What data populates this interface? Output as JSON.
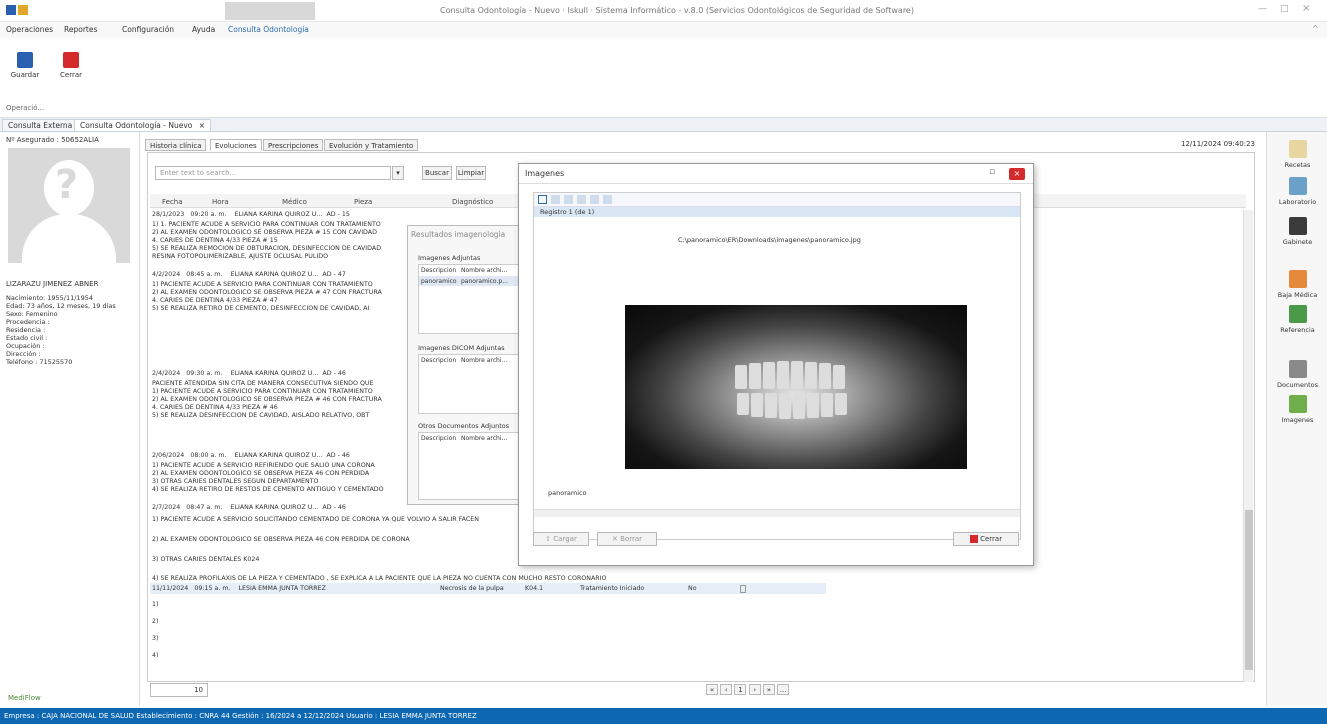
{
  "window": {
    "title": "Consulta Odontología - Nuevo · Iskull · Sistema Informático - v.8.0 (Servicios Odontológicos de Seguridad de Software)",
    "controls": [
      "—",
      "□",
      "×"
    ]
  },
  "menu": {
    "items": [
      "Operaciones",
      "Reportes",
      "Configuración",
      "Ayuda",
      "Consulta Odontología"
    ]
  },
  "ribbon": {
    "guardar": "Guardar",
    "cerrar": "Cerrar",
    "group": "Operació..."
  },
  "doc_tabs": [
    "Consulta Externa",
    "Consulta Odontología - Nuevo"
  ],
  "patient": {
    "asegurado": "Nº Asegurado : 50652ALIA",
    "name": "LIZARAZU JIMENEZ ABNER",
    "lines": [
      "Nacimiento: 1955/11/1954",
      "Edad: 73 años, 12 meses, 19 días",
      "Sexo: Femenino",
      "Procedencia :",
      "Residencia :",
      "Estado civil :",
      "Ocupación :",
      "Dirección :",
      "Teléfono : 71525570"
    ]
  },
  "main": {
    "tabs": [
      "Historia clínica",
      "Evoluciones",
      "Prescripciones",
      "Evolución y Tratamiento"
    ],
    "date": "12/11/2024 09:40:23",
    "search_placeholder": "Enter text to search...",
    "buscar": "Buscar",
    "limpiar": "Limpiar",
    "headers": [
      "Fecha",
      "Hora",
      "Médico",
      "Pieza",
      "Diagnóstico"
    ],
    "records": [
      {
        "fecha": "28/1/2023",
        "hora": "09:20 a. m.",
        "medico": "ELIANA KARINA QUIROZ U...",
        "pieza": "AD - 15",
        "lines": [
          "1) 1. PACIENTE ACUDE A SERVICIO PARA CONTINUAR CON TRATAMIENTO",
          "2) AL EXAMEN ODONTOLOGICO SE OBSERVA PIEZA # 15 CON CAVIDAD",
          "4. CARIES DE DENTINA 4/33 PIEZA # 15",
          "5) SE REALIZA REMOCION DE OBTURACION, DESINFECCION DE CAVIDAD",
          "RESINA FOTOPOLIMERIZABLE, AJUSTE OCLUSAL PULIDO"
        ]
      },
      {
        "fecha": "4/2/2024",
        "hora": "08:45 a. m.",
        "medico": "ELIANA KARINA QUIROZ U...",
        "pieza": "AD - 47",
        "lines": [
          "1) PACIENTE ACUDE A SERVICIO PARA CONTINUAR CON TRATAMIENTO",
          "2) AL EXAMEN ODONTOLOGICO SE OBSERVA PIEZA # 47 CON FRACTURA",
          "4. CARIES DE DENTINA 4/33 PIEZA # 47",
          "5) SE REALIZA RETIRO DE CEMENTO, DESINFECCION DE CAVIDAD, AI"
        ]
      },
      {
        "fecha": "2/4/2024",
        "hora": "09:30 a. m.",
        "medico": "ELIANA KARINA QUIROZ U...",
        "pieza": "AD - 46",
        "lines": [
          "PACIENTE ATENDIDA SIN CITA DE MANERA CONSECUTIVA SIENDO QUE",
          "1) PACIENTE ACUDE A SERVICIO PARA CONTINUAR CON TRATAMIENTO",
          "2) AL EXAMEN ODONTOLOGICO SE OBSERVA PIEZA # 46 CON FRACTURA",
          "4. CARIES DE DENTINA 4/33 PIEZA # 46",
          "5) SE REALIZA DESINFECCION DE CAVIDAD, AISLADO RELATIVO, OBT"
        ]
      },
      {
        "fecha": "2/06/2024",
        "hora": "08:00 a. m.",
        "medico": "ELIANA KARINA QUIROZ U...",
        "pieza": "AD - 46",
        "lines": [
          "1) PACIENTE ACUDE A SERVICIO REFIRIENDO QUE SALIO UNA CORONA",
          "2) AL EXAMEN ODONTOLOGICO SE OBSERVA PIEZA 46 CON PERDIDA",
          "3) OTRAS CARIES DENTALES SEGUN DEPARTAMENTO",
          "4) SE REALIZA RETIRO DE RESTOS DE CEMENTO ANTIGUO Y CEMENTADO"
        ]
      },
      {
        "fecha": "2/7/2024",
        "hora": "08:47 a. m.",
        "medico": "ELIANA KARINA QUIROZ U...",
        "pieza": "AD - 46",
        "lines": [
          "1) PACIENTE ACUDE A SERVICIO SOLICITANDO CEMENTADO DE CORONA YA QUE VOLVIO A SALIR FACEN",
          "2) AL EXAMEN ODONTOLOGICO SE OBSERVA PIEZA 46 CON PERDIDA DE CORONA",
          "3) OTRAS CARIES DENTALES K024",
          "4) SE REALIZA PROFILAXIS DE LA PIEZA Y CEMENTADO , SE EXPLICA A LA PACIENTE QUE LA PIEZA NO CUENTA CON MUCHO RESTO CORONARIO"
        ]
      },
      {
        "fecha": "11/11/2024",
        "hora": "09:15 a. m.",
        "medico": "LESIA EMMA JUNTA TORREZ",
        "pieza": "",
        "lines": [
          "1)",
          "2)",
          "3)",
          "4)"
        ],
        "extra": [
          "Necrosis de la pulpa",
          "K04.1",
          "Tratamiento Iniciado",
          "No"
        ]
      }
    ],
    "pagination": [
      "«",
      "‹",
      "1",
      "›",
      "»",
      "…"
    ],
    "footer_combo": "10"
  },
  "behind_dialog": {
    "title": "Resultados imagenologia",
    "section1": "Imagenes Adjuntas",
    "col1": "Descripcion",
    "col2": "Nombre archi...",
    "row1a": "panoramico",
    "row1b": "panoramico.p...",
    "section2": "Imagenes DICOM Adjuntas",
    "col3": "Descripcion",
    "col4": "Nombre archi...",
    "section3": "Otros Documentos Adjuntos",
    "col5": "Descripcion",
    "col6": "Nombre archi..."
  },
  "image_dialog": {
    "title": "Imagenes",
    "record": "Registro 1 (de 1)",
    "path": "C:\\panoramico\\ER\\Downloads\\imagenes\\panoramico.jpg",
    "caption": "panoramico",
    "cargar": "Cargar",
    "borrar": "Borrar",
    "cerrar": "Cerrar"
  },
  "right_tools": [
    "Recetas",
    "Laboratorio",
    "Gabinete",
    "Baja Médica",
    "Referencia",
    "Documentos",
    "Imagenes"
  ],
  "status": "Empresa : CAJA NACIONAL DE SALUD   Establecimiento : CNRA 44   Gestión : 16/2024 a 12/12/2024   Usuario : LESIA EMMA JUNTA TORREZ",
  "colors": {
    "status_bg": "#0e67b1",
    "accent": "#2b6cb0",
    "danger": "#d32b2b"
  }
}
